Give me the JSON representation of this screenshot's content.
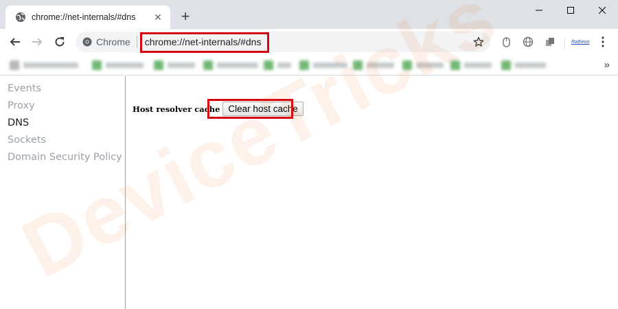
{
  "tab": {
    "title": "chrome://net-internals/#dns",
    "close": "✕",
    "new_tab": "+"
  },
  "omnibox": {
    "origin_label": "Chrome",
    "url": "chrome://net-internals/#dns"
  },
  "extensions": {
    "profile_label": "Ratheon"
  },
  "bookmarks": {
    "more": "»",
    "item_count": 10
  },
  "sidebar": {
    "items": [
      {
        "label": "Events",
        "active": false
      },
      {
        "label": "Proxy",
        "active": false
      },
      {
        "label": "DNS",
        "active": true
      },
      {
        "label": "Sockets",
        "active": false
      },
      {
        "label": "Domain Security Policy",
        "active": false
      }
    ]
  },
  "main": {
    "host_resolver_label": "Host resolver cache",
    "clear_button_label": "Clear host cache"
  },
  "watermark": {
    "text": "DeviceTricks"
  },
  "colors": {
    "highlight": "#d6000f",
    "tabstrip": "#dee1e6",
    "watermark": "#ea7828"
  }
}
